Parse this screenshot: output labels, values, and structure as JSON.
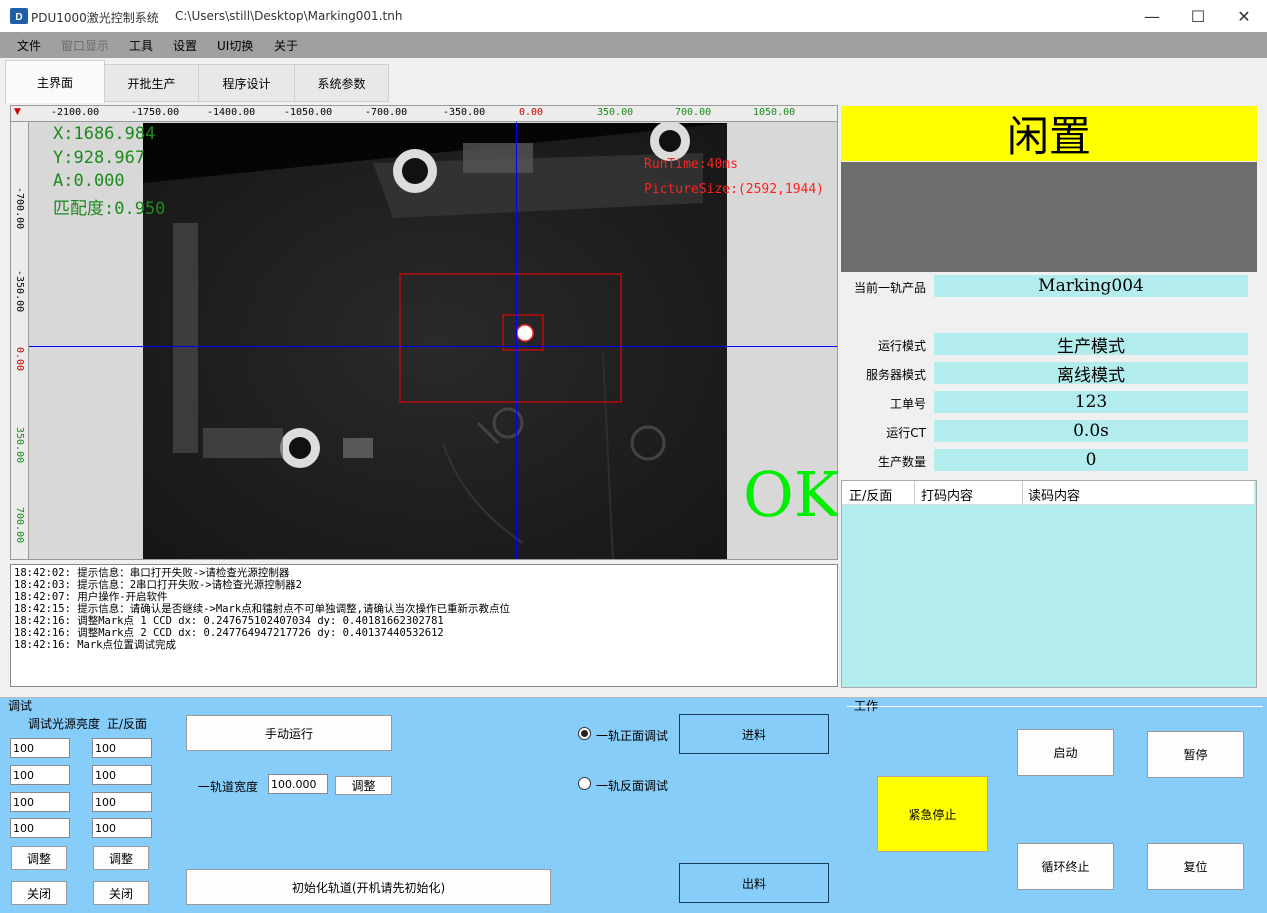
{
  "window": {
    "app_title": "PDU1000激光控制系统",
    "file_path": "C:\\Users\\still\\Desktop\\Marking001.tnh",
    "minimize": "—",
    "maximize": "☐",
    "close": "✕"
  },
  "menu": [
    {
      "label": "文件",
      "enabled": true
    },
    {
      "label": "窗口显示",
      "enabled": false
    },
    {
      "label": "工具",
      "enabled": true
    },
    {
      "label": "设置",
      "enabled": true
    },
    {
      "label": "UI切换",
      "enabled": true
    },
    {
      "label": "关于",
      "enabled": true
    }
  ],
  "tabs": [
    {
      "label": "主界面",
      "active": true
    },
    {
      "label": "开批生产",
      "active": false
    },
    {
      "label": "程序设计",
      "active": false
    },
    {
      "label": "系统参数",
      "active": false
    }
  ],
  "view": {
    "ruler_top": [
      "-2100.00",
      "-1750.00",
      "-1400.00",
      "-1050.00",
      "-700.00",
      "-350.00",
      "0.00",
      "350.00",
      "700.00",
      "1050.00"
    ],
    "ruler_left": [
      "-700.00",
      "-350.00",
      "0.00",
      "350.00",
      "700.00"
    ],
    "coords": {
      "x": "X:1686.984",
      "y": "Y:928.967",
      "a": "A:0.000",
      "match": "匹配度:0.950"
    },
    "run_time": "RunTime:40ms",
    "picture_size": "PictureSize:(2592,1944)",
    "result": "OK",
    "colors": {
      "crosshair": "#0000ff",
      "roi": "#ff0000",
      "result": "#00ee00",
      "coords": "#1c8a1c"
    }
  },
  "log": [
    "18:42:02:  提示信息：串口打开失败->请检查光源控制器",
    "18:42:03:  提示信息：2串口打开失败->请检查光源控制器2",
    "18:42:07:  用户操作-开启软件",
    "18:42:15:  提示信息：请确认是否继续->Mark点和镭射点不可单独调整,请确认当次操作已重新示教点位",
    "18:42:16:  调整Mark点 1 CCD dx: 0.247675102407034 dy: 0.40181662302781",
    "18:42:16:  调整Mark点 2 CCD dx: 0.247764947217726 dy: 0.40137440532612",
    "18:42:16:  Mark点位置调试完成"
  ],
  "status": {
    "state": "闲置",
    "state_color": "#ffff00",
    "rows": [
      {
        "label": "当前一轨产品",
        "value": "Marking004"
      },
      {
        "label": "运行模式",
        "value": "生产模式"
      },
      {
        "label": "服务器模式",
        "value": "离线模式"
      },
      {
        "label": "工单号",
        "value": "123"
      },
      {
        "label": "运行CT",
        "value": "0.0s"
      },
      {
        "label": "生产数量",
        "value": "0"
      }
    ]
  },
  "read_table": {
    "columns": [
      "正/反面",
      "打码内容",
      "读码内容"
    ],
    "rows": []
  },
  "debug": {
    "title": "调试",
    "light_label": "调试光源亮度",
    "face_label": "正/反面",
    "light_values": [
      "100",
      "100",
      "100",
      "100"
    ],
    "face_values": [
      "100",
      "100",
      "100",
      "100"
    ],
    "adjust_label": "调整",
    "close_label": "关闭",
    "manual_run": "手动运行",
    "track_width_label": "一轨道宽度",
    "track_width_value": "100.000",
    "track_adjust": "调整",
    "init_track": "初始化轨道(开机请先初始化)",
    "radio_front": "一轨正面调试",
    "radio_back": "一轨反面调试",
    "radio_selected": "front",
    "feed_in": "进料",
    "feed_out": "出料"
  },
  "work": {
    "title": "工作",
    "estop": "紧急停止",
    "start": "启动",
    "pause": "暂停",
    "loop_end": "循环终止",
    "reset": "复位"
  }
}
